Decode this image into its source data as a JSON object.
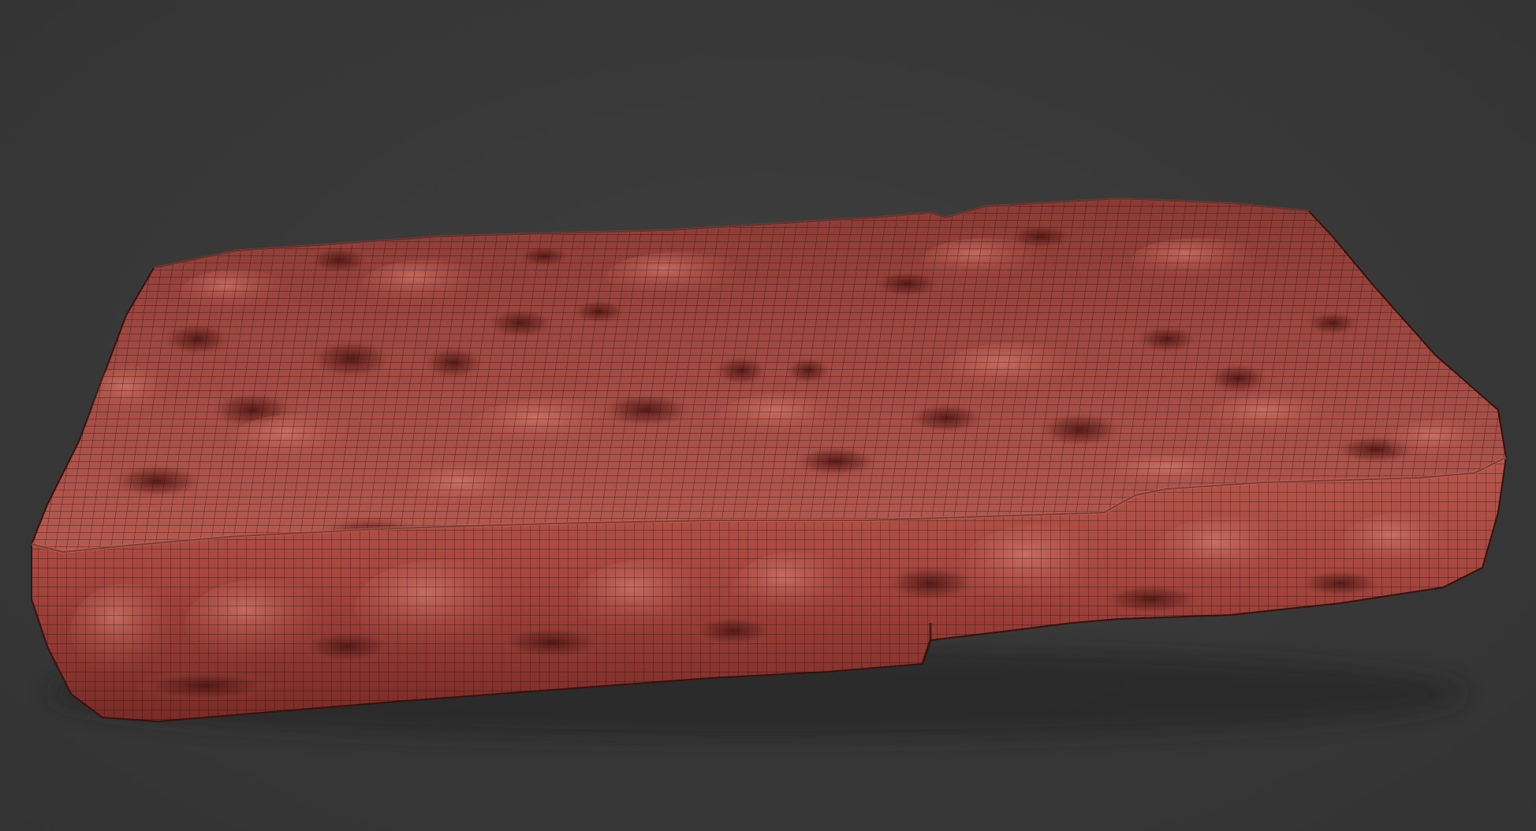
{
  "viewport": {
    "background_color": "#3a3a3a",
    "model": {
      "name": "",
      "material_color": "#a8483f",
      "highlight_color": "#c96a5e",
      "shadow_color": "#5e1f1b",
      "wire_color": "#2a0b09",
      "display_mode": "polyframe-wireframe-overlay"
    }
  }
}
